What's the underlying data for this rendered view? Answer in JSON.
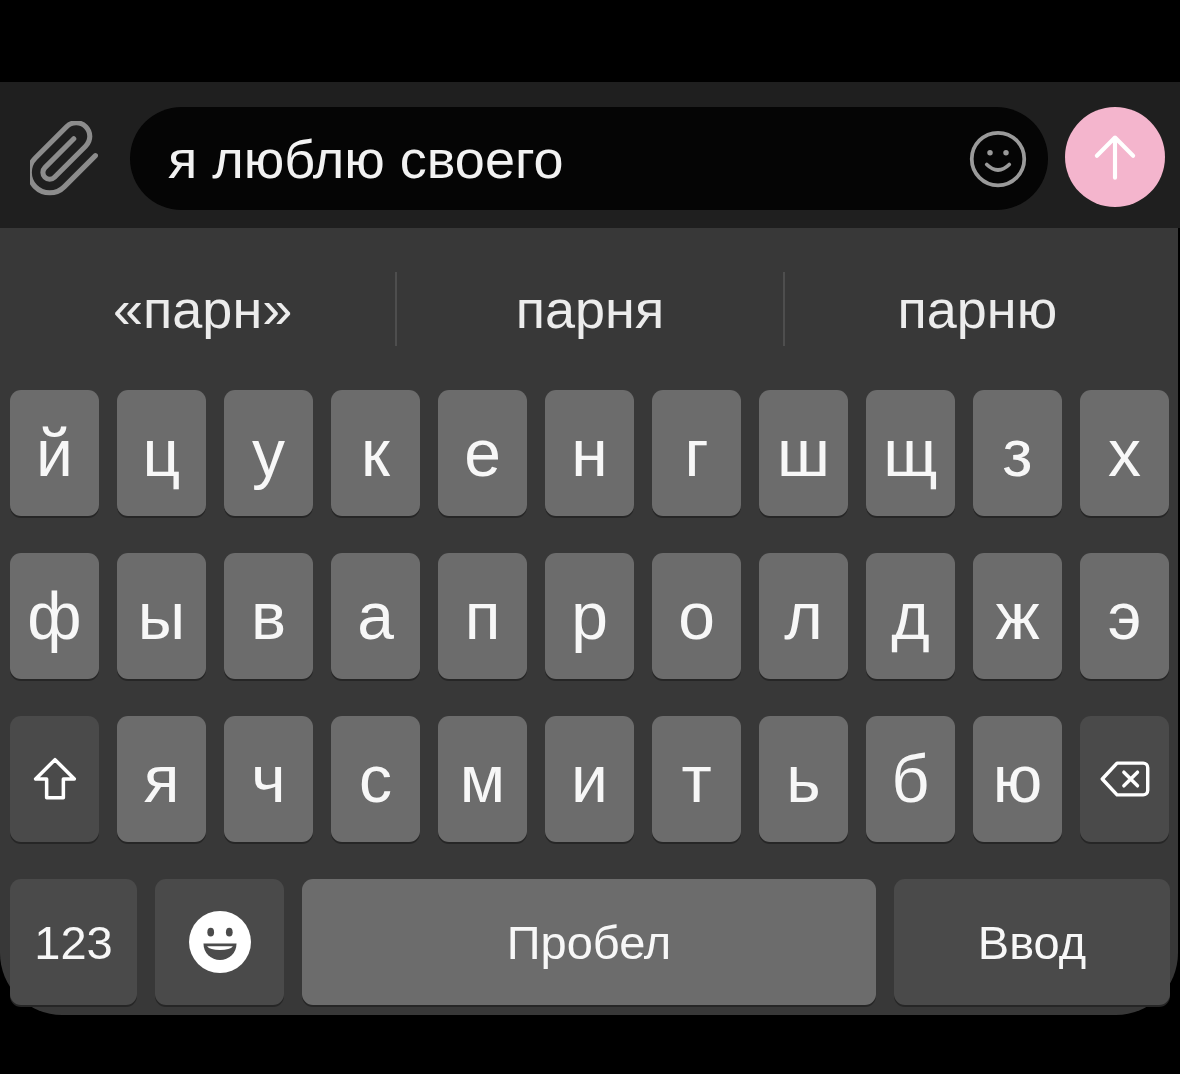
{
  "input_bar": {
    "message": "я люблю своего"
  },
  "suggestions": [
    "«парн»",
    "парня",
    "парню"
  ],
  "keyboard": {
    "rows": [
      {
        "keys": [
          {
            "kind": "letter",
            "label": "й"
          },
          {
            "kind": "letter",
            "label": "ц"
          },
          {
            "kind": "letter",
            "label": "у"
          },
          {
            "kind": "letter",
            "label": "к"
          },
          {
            "kind": "letter",
            "label": "е"
          },
          {
            "kind": "letter",
            "label": "н"
          },
          {
            "kind": "letter",
            "label": "г"
          },
          {
            "kind": "letter",
            "label": "ш"
          },
          {
            "kind": "letter",
            "label": "щ"
          },
          {
            "kind": "letter",
            "label": "з"
          },
          {
            "kind": "letter",
            "label": "х"
          }
        ]
      },
      {
        "keys": [
          {
            "kind": "letter",
            "label": "ф"
          },
          {
            "kind": "letter",
            "label": "ы"
          },
          {
            "kind": "letter",
            "label": "в"
          },
          {
            "kind": "letter",
            "label": "а"
          },
          {
            "kind": "letter",
            "label": "п"
          },
          {
            "kind": "letter",
            "label": "р"
          },
          {
            "kind": "letter",
            "label": "о"
          },
          {
            "kind": "letter",
            "label": "л"
          },
          {
            "kind": "letter",
            "label": "д"
          },
          {
            "kind": "letter",
            "label": "ж"
          },
          {
            "kind": "letter",
            "label": "э"
          }
        ]
      },
      {
        "keys": [
          {
            "kind": "shift"
          },
          {
            "kind": "letter",
            "label": "я"
          },
          {
            "kind": "letter",
            "label": "ч"
          },
          {
            "kind": "letter",
            "label": "с"
          },
          {
            "kind": "letter",
            "label": "м"
          },
          {
            "kind": "letter",
            "label": "и"
          },
          {
            "kind": "letter",
            "label": "т"
          },
          {
            "kind": "letter",
            "label": "ь"
          },
          {
            "kind": "letter",
            "label": "б"
          },
          {
            "kind": "letter",
            "label": "ю"
          },
          {
            "kind": "delete"
          }
        ]
      },
      {
        "keys": [
          {
            "kind": "numbers",
            "label": "123"
          },
          {
            "kind": "emoji"
          },
          {
            "kind": "space",
            "label": "Пробел"
          },
          {
            "kind": "enter",
            "label": "Ввод"
          }
        ]
      }
    ]
  }
}
